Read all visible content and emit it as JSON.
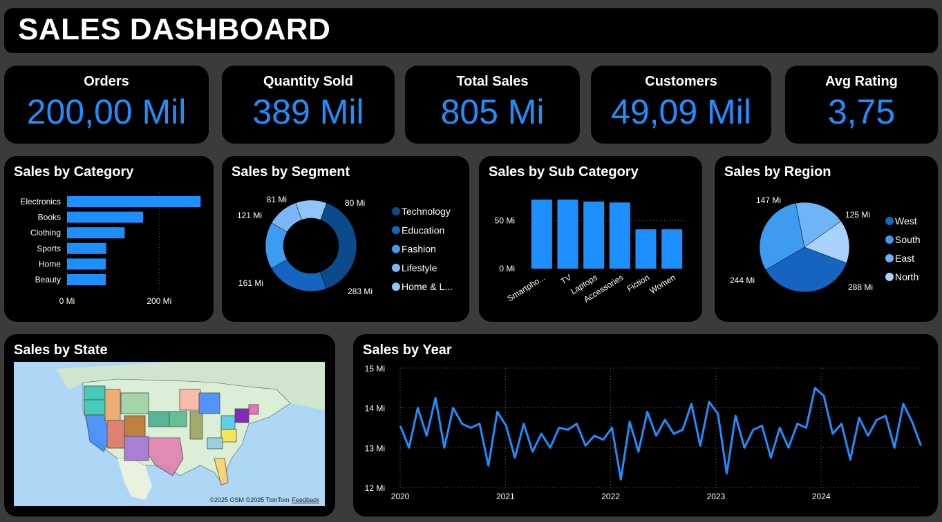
{
  "header": {
    "title": "SALES DASHBOARD"
  },
  "kpis": [
    {
      "label": "Orders",
      "value": "200,00 Mil"
    },
    {
      "label": "Quantity Sold",
      "value": "389 Mil"
    },
    {
      "label": "Total Sales",
      "value": "805 Mi"
    },
    {
      "label": "Customers",
      "value": "49,09 Mil"
    },
    {
      "label": "Avg Rating",
      "value": "3,75"
    }
  ],
  "colors": {
    "accent": "#1e8fff",
    "panel": "#000000",
    "background": "#3b3b3b"
  },
  "charts": {
    "category": {
      "title": "Sales by Category"
    },
    "segment": {
      "title": "Sales by Segment"
    },
    "subcategory": {
      "title": "Sales by Sub Category"
    },
    "region": {
      "title": "Sales by Region"
    },
    "state": {
      "title": "Sales by State",
      "credit": "©2025 OSM  ©2025 TomTom",
      "feedback": "Feedback"
    },
    "year": {
      "title": "Sales by Year"
    }
  },
  "chart_data": [
    {
      "id": "category",
      "type": "bar",
      "orientation": "horizontal",
      "title": "Sales by Category",
      "categories": [
        "Electronics",
        "Books",
        "Clothing",
        "Sports",
        "Home",
        "Beauty"
      ],
      "values": [
        290,
        165,
        125,
        85,
        84,
        84
      ],
      "xlim": [
        0,
        300
      ],
      "x_ticks": [
        "0 Mi",
        "200 Mi"
      ],
      "x_tick_values": [
        0,
        200
      ],
      "grid": true
    },
    {
      "id": "segment",
      "type": "pie",
      "donut": true,
      "title": "Sales by Segment",
      "labels": [
        "Technology",
        "Education",
        "Fashion",
        "Lifestyle",
        "Home & L..."
      ],
      "values": [
        283,
        161,
        121,
        81,
        80
      ],
      "value_labels": [
        "283 Mi",
        "161 Mi",
        "121 Mi",
        "81 Mi",
        "80 Mi"
      ],
      "colors": [
        "#0b4b8c",
        "#1565c0",
        "#3d9bf0",
        "#7ab8f5",
        "#8fc6f7"
      ],
      "legend": "right"
    },
    {
      "id": "subcategory",
      "type": "bar",
      "title": "Sales by Sub Category",
      "categories": [
        "Smartpho...",
        "TV",
        "Laptops",
        "Accessories",
        "Fiction",
        "Women"
      ],
      "values": [
        72,
        72,
        70,
        69,
        41,
        41
      ],
      "ylim": [
        0,
        80
      ],
      "y_ticks": [
        "0 Mi",
        "50 Mi"
      ],
      "y_tick_values": [
        0,
        50
      ],
      "grid": true
    },
    {
      "id": "region",
      "type": "pie",
      "title": "Sales by Region",
      "labels": [
        "West",
        "South",
        "East",
        "North"
      ],
      "values": [
        288,
        244,
        147,
        125
      ],
      "value_labels": [
        "288 Mi",
        "244 Mi",
        "147 Mi",
        "125 Mi"
      ],
      "colors": [
        "#1565c0",
        "#3d9bf0",
        "#6fb4f5",
        "#a9d2fa"
      ],
      "legend": "right"
    },
    {
      "id": "year",
      "type": "line",
      "title": "Sales by Year",
      "ylim": [
        12,
        15
      ],
      "y_ticks": [
        "12 Mi",
        "13 Mi",
        "14 Mi",
        "15 Mi"
      ],
      "y_tick_values": [
        12,
        13,
        14,
        15
      ],
      "x_ticks": [
        "2020",
        "2021",
        "2022",
        "2023",
        "2024"
      ],
      "x_start": 2020,
      "x_end": 2025,
      "grid": true,
      "values": [
        13.55,
        13.0,
        14.0,
        13.3,
        14.25,
        13.0,
        14.0,
        13.6,
        13.5,
        13.6,
        12.55,
        13.9,
        13.55,
        12.75,
        13.6,
        12.9,
        13.35,
        13.0,
        13.5,
        13.45,
        13.6,
        13.05,
        13.3,
        13.2,
        13.5,
        12.2,
        13.65,
        12.9,
        13.9,
        13.3,
        13.7,
        13.35,
        13.45,
        14.1,
        13.05,
        14.15,
        13.85,
        12.35,
        13.8,
        13.0,
        13.45,
        13.55,
        12.75,
        13.5,
        13.0,
        13.6,
        13.5,
        14.5,
        14.3,
        13.35,
        13.6,
        12.7,
        13.75,
        13.3,
        13.7,
        13.8,
        13.0,
        14.1,
        13.65,
        13.05
      ]
    }
  ]
}
